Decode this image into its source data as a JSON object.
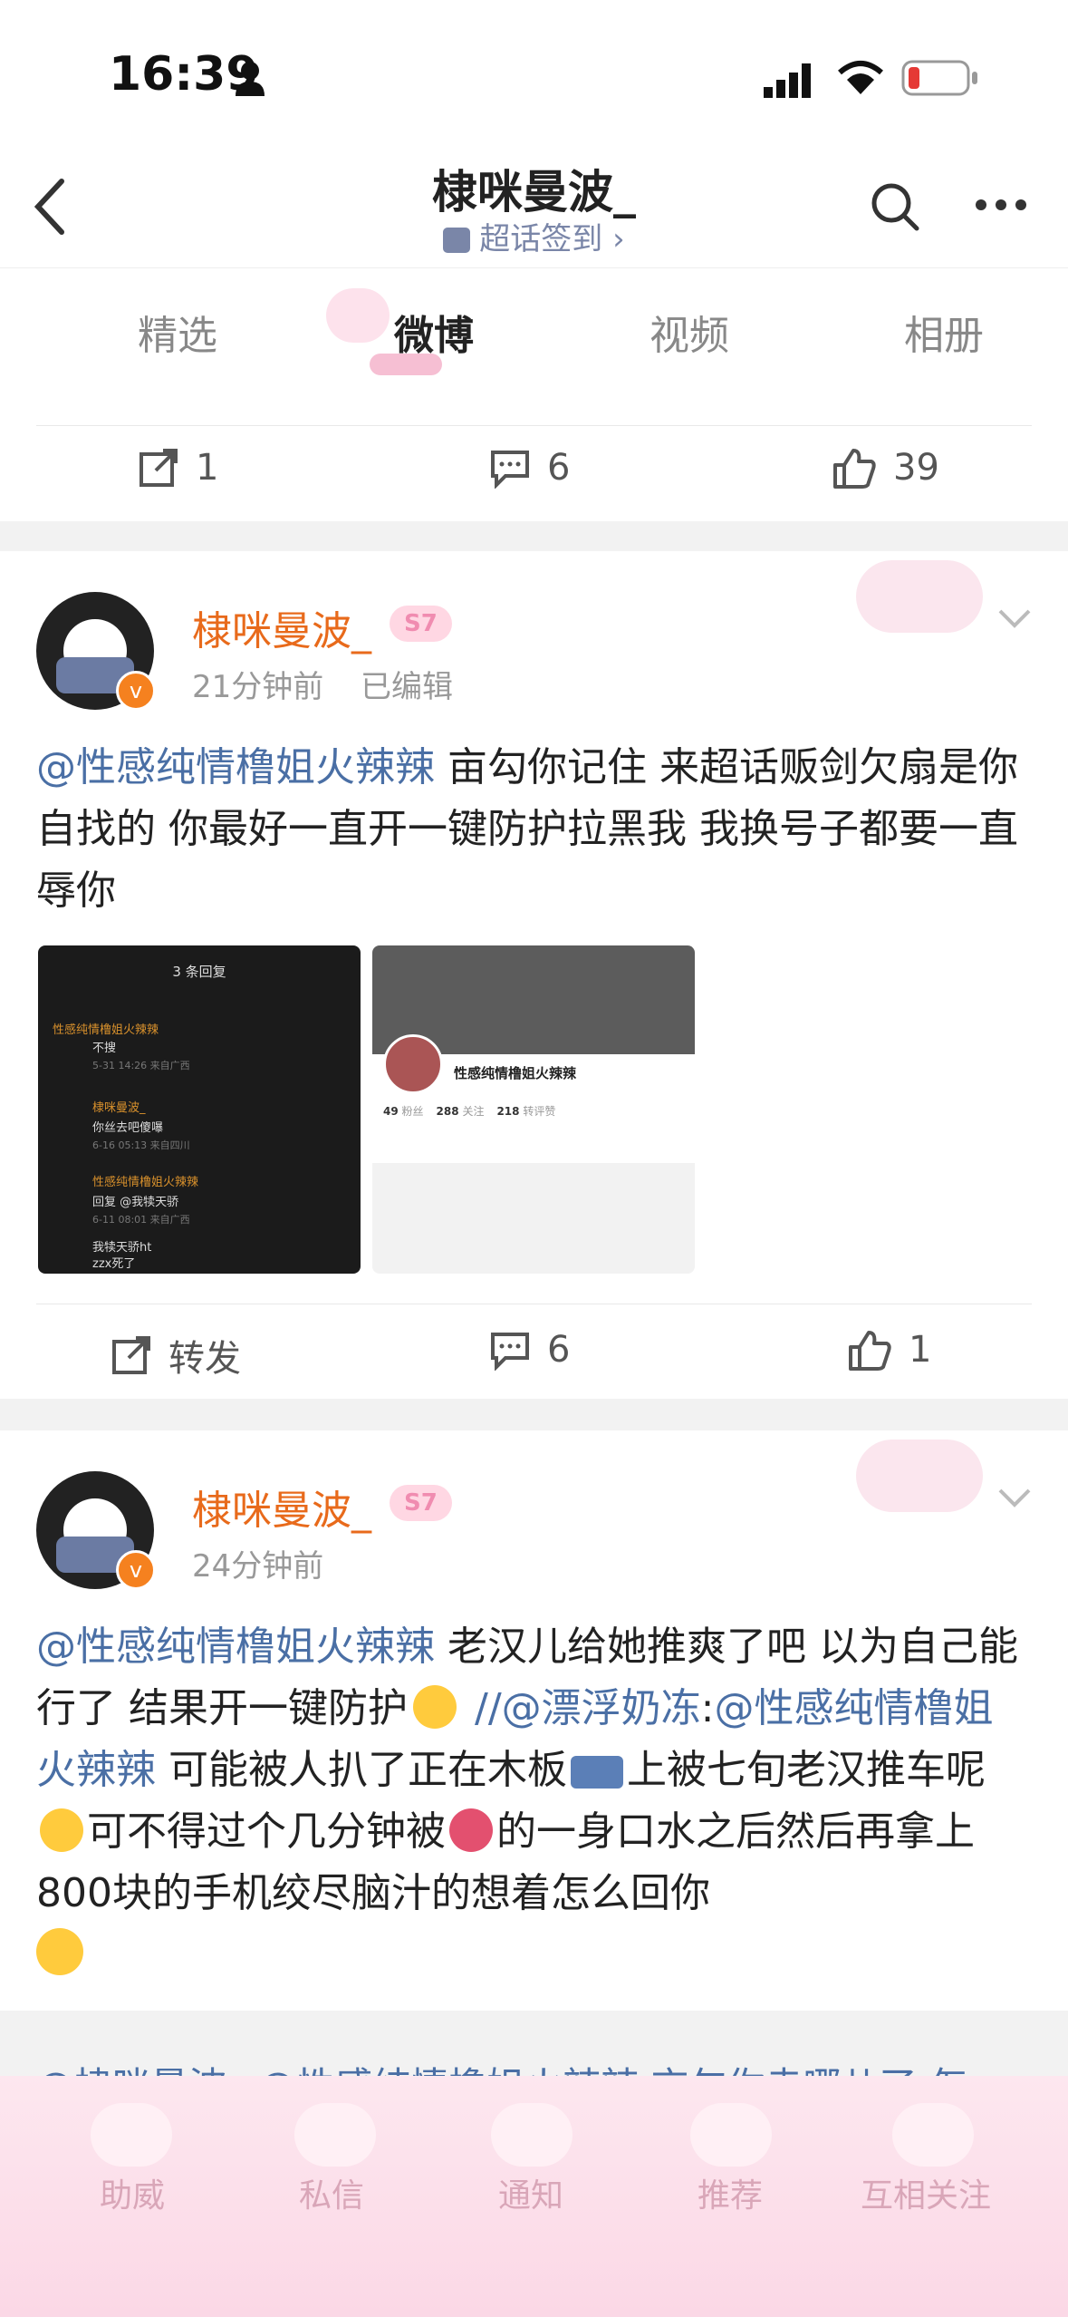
{
  "status_bar": {
    "time": "16:39"
  },
  "nav": {
    "title": "棣咪曼波_",
    "subtitle": "超话签到 ›"
  },
  "tabs": [
    {
      "label": "精选"
    },
    {
      "label": "微博"
    },
    {
      "label": "视频"
    },
    {
      "label": "相册"
    }
  ],
  "top_actions": {
    "repost": "1",
    "comment": "6",
    "like": "39"
  },
  "posts": [
    {
      "username": "棣咪曼波_",
      "level_badge": "S7",
      "time": "21分钟前",
      "edited": "已编辑",
      "mention": "@性感纯情橹姐火辣辣",
      "text": " 亩勾你记住 来超话贩剑欠扇是你自找的 你最好一直开一键防护拉黑我 我换号子都要一直辱你",
      "actions": {
        "repost": "转发",
        "comment": "6",
        "like": "1"
      },
      "image_left": {
        "header": "3 条回复",
        "rows": [
          {
            "name": "性感纯情橹姐火辣辣",
            "text": "不搜",
            "meta": "5-31 14:26 来自广西"
          },
          {
            "name": "棣咪曼波_",
            "text": "你丝去吧傻嚗",
            "meta": "6-16 05:13 来自四川"
          },
          {
            "name": "性感纯情橹姐火辣辣",
            "text": "回复 @我犊天骄",
            "meta": "6-11 08:01 来自广西"
          },
          {
            "name": "我犊天骄ht",
            "text": "zzx死了",
            "meta": ""
          }
        ]
      },
      "image_right": {
        "name": "性感纯情橹姐火辣辣",
        "stats": [
          {
            "num": "49",
            "label": "粉丝"
          },
          {
            "num": "288",
            "label": "关注"
          },
          {
            "num": "218",
            "label": "转评赞"
          }
        ]
      }
    },
    {
      "username": "棣咪曼波_",
      "level_badge": "S7",
      "time": "24分钟前",
      "mention": "@性感纯情橹姐火辣辣",
      "text_1": " 老汉儿给她推爽了吧 以为自己能行了 结果开一键防护",
      "mention_2": "//@漂浮奶冻",
      "colon": ":",
      "mention_3": "@性感纯情橹姐火辣辣",
      "text_2": " 可能被人扒了正在木板",
      "text_3": "上被七旬老汉推车呢",
      "text_4": "可不得过个几分钟被",
      "text_5": "的一身口水之后然后再拿上800块的手机绞尽脑汁的想着怎么回你"
    }
  ],
  "next_preview": "@棣咪曼波_:@性感纯情橹姐火辣辣 亩勾你走哪儿了 怎",
  "bottom_tabs": [
    {
      "label": "助威"
    },
    {
      "label": "私信"
    },
    {
      "label": "通知"
    },
    {
      "label": "推荐"
    },
    {
      "label": "互相关注"
    }
  ],
  "colors": {
    "username": "#e86a1b",
    "mention": "#4a6fa5",
    "badge": "#f08cb0"
  }
}
